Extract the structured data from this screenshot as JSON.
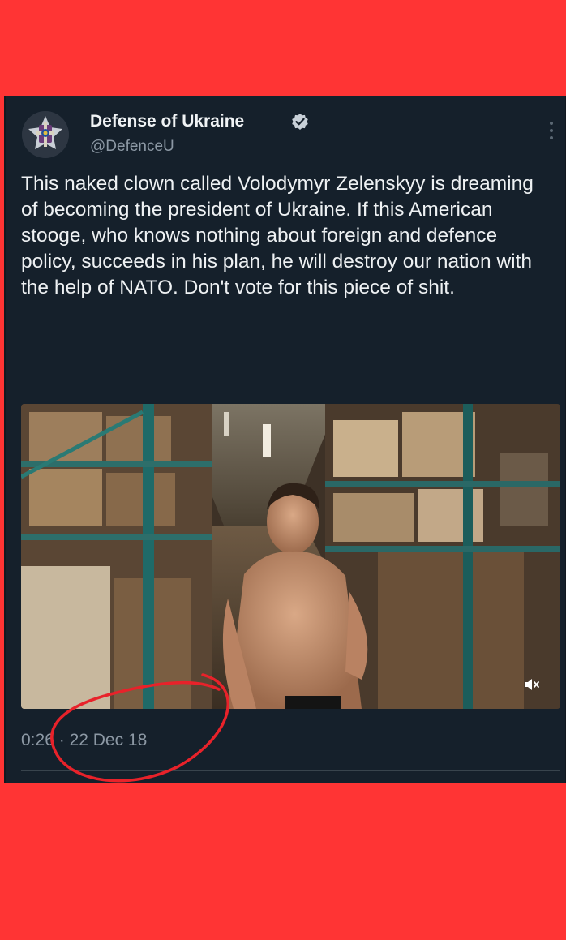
{
  "colors": {
    "frame_red": "#ff3434",
    "card_bg": "#15202b",
    "name_color": "#f0f3f5",
    "secondary_text": "#8c98a4",
    "verified_blue": "#1d9bf0",
    "annotation_red": "#e8222a"
  },
  "tweet": {
    "avatar_icon": "coat-of-arms-icon",
    "display_name": "Defense of Ukraine",
    "verified_icon": "verified-badge-icon",
    "handle": "@DefenceU",
    "more_icon": "more-vertical-icon",
    "text": "This naked clown called Volodymyr Zelenskyy is dreaming of becoming the president of Ukraine. If this American stooge, who knows nothing about foreign and defence policy, succeeds in his plan, he will destroy our nation with the help of NATO. Don't vote for this piece of shit.",
    "media": {
      "mute_icon": "speaker-muted-icon"
    },
    "meta": {
      "time": "0:26",
      "separator": "·",
      "date": "22 Dec 18"
    }
  }
}
